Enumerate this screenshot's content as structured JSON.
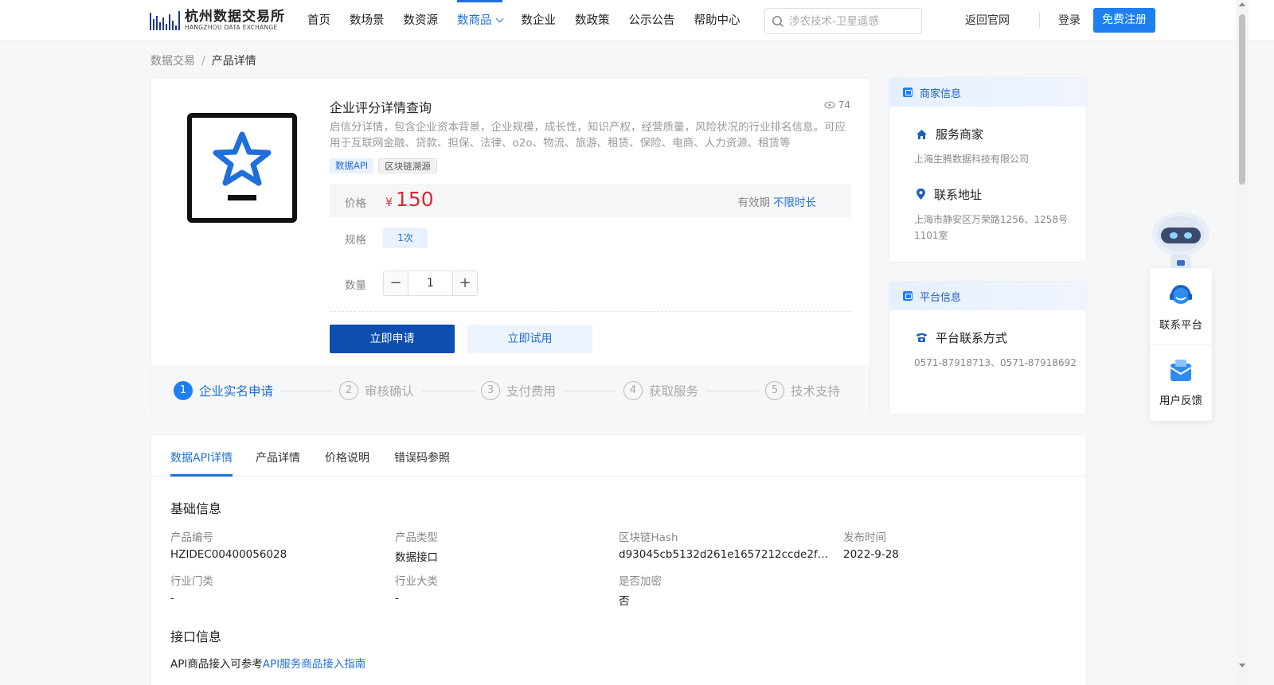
{
  "header": {
    "logo_cn": "杭州数据交易所",
    "logo_en": "HANGZHOU DATA EXCHANGE",
    "nav": [
      {
        "label": "首页"
      },
      {
        "label": "数场景"
      },
      {
        "label": "数资源"
      },
      {
        "label": "数商品",
        "active": true
      },
      {
        "label": "数企业"
      },
      {
        "label": "数政策"
      },
      {
        "label": "公示公告"
      },
      {
        "label": "帮助中心"
      }
    ],
    "search_placeholder": "涉农技术-卫星遥感",
    "back_link": "返回官网",
    "login": "登录",
    "register": "免费注册"
  },
  "breadcrumb": {
    "root": "数据交易",
    "sep": "/",
    "current": "产品详情"
  },
  "product": {
    "title": "企业评分详情查询",
    "views": "74",
    "description": "启信分详情，包含企业资本背景，企业规模，成长性，知识产权，经营质量，风险状况的行业排名信息。可应用于互联网金融、贷款、担保、法律、o2o、物流、旅游、租赁、保险、电商、人力资源、租赁等",
    "tags": [
      "数据API",
      "区块链溯源"
    ],
    "price_label": "价格",
    "currency": "¥",
    "price": "150",
    "validity_label": "有效期",
    "validity_value": "不限时长",
    "spec_label": "规格",
    "spec_value": "1次",
    "qty_label": "数量",
    "qty_minus": "−",
    "qty_value": "1",
    "qty_plus": "+",
    "apply_button": "立即申请",
    "trial_button": "立即试用",
    "steps": [
      {
        "num": "1",
        "label": "企业实名申请",
        "active": true
      },
      {
        "num": "2",
        "label": "审核确认"
      },
      {
        "num": "3",
        "label": "支付费用"
      },
      {
        "num": "4",
        "label": "获取服务"
      },
      {
        "num": "5",
        "label": "技术支持"
      }
    ]
  },
  "merchant_card": {
    "header": "商家信息",
    "service_title": "服务商家",
    "service_value": "上海生腾数据科技有限公司",
    "address_title": "联系地址",
    "address_value": "上海市静安区万荣路1256、1258号1101室"
  },
  "platform_card": {
    "header": "平台信息",
    "contact_title": "平台联系方式",
    "contact_value": "0571-87918713、0571-87918692"
  },
  "float": {
    "contact": "联系平台",
    "feedback": "用户反馈"
  },
  "details": {
    "tabs": [
      {
        "label": "数据API详情",
        "active": true
      },
      {
        "label": "产品详情"
      },
      {
        "label": "价格说明"
      },
      {
        "label": "错误码参照"
      }
    ],
    "basic_title": "基础信息",
    "fields": [
      {
        "label": "产品编号",
        "value": "HZIDEC00400056028"
      },
      {
        "label": "产品类型",
        "value": "数据接口"
      },
      {
        "label": "区块链Hash",
        "value": "d93045cb5132d261e1657212ccde2f0925…"
      },
      {
        "label": "发布时间",
        "value": "2022-9-28"
      },
      {
        "label": "行业门类",
        "value": "-"
      },
      {
        "label": "行业大类",
        "value": "-"
      },
      {
        "label": "是否加密",
        "value": "否"
      }
    ],
    "api_title": "接口信息",
    "api_note_prefix": "API商品接入可参考",
    "api_note_link": "API服务商品接入指南"
  },
  "colors": {
    "accent": "#1e6fd9",
    "primary_button": "#0d4fb0",
    "price": "#d62d2d"
  }
}
